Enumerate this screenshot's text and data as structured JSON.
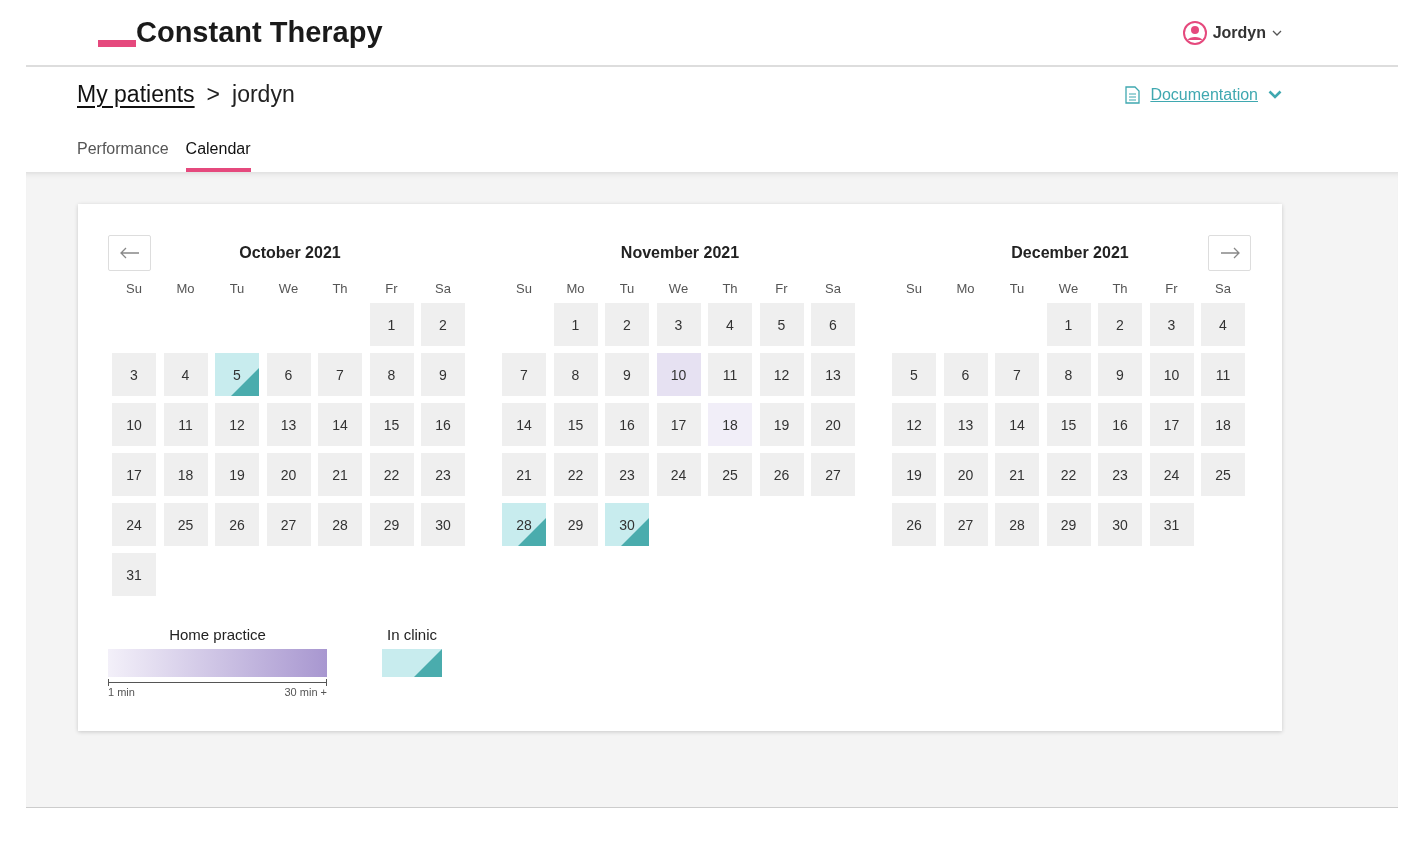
{
  "header": {
    "logo": "Constant Therapy",
    "user": "Jordyn"
  },
  "breadcrumb": {
    "link": "My patients",
    "separator": ">",
    "current": "jordyn"
  },
  "documentation": "Documentation",
  "tabs": [
    {
      "label": "Performance",
      "selected": false
    },
    {
      "label": "Calendar",
      "selected": true
    }
  ],
  "months": [
    {
      "title": "October 2021",
      "weekdays": [
        "Su",
        "Mo",
        "Tu",
        "We",
        "Th",
        "Fr",
        "Sa"
      ],
      "days": [
        {
          "kind": "blank"
        },
        {
          "kind": "blank"
        },
        {
          "kind": "blank"
        },
        {
          "kind": "blank"
        },
        {
          "kind": "blank"
        },
        {
          "day": "1",
          "kind": "none"
        },
        {
          "day": "2",
          "kind": "none"
        },
        {
          "day": "3",
          "kind": "none"
        },
        {
          "day": "4",
          "kind": "none"
        },
        {
          "day": "5",
          "kind": "clinic"
        },
        {
          "day": "6",
          "kind": "none"
        },
        {
          "day": "7",
          "kind": "none"
        },
        {
          "day": "8",
          "kind": "none"
        },
        {
          "day": "9",
          "kind": "none"
        },
        {
          "day": "10",
          "kind": "none"
        },
        {
          "day": "11",
          "kind": "none"
        },
        {
          "day": "12",
          "kind": "none"
        },
        {
          "day": "13",
          "kind": "none"
        },
        {
          "day": "14",
          "kind": "none"
        },
        {
          "day": "15",
          "kind": "none"
        },
        {
          "day": "16",
          "kind": "none"
        },
        {
          "day": "17",
          "kind": "none"
        },
        {
          "day": "18",
          "kind": "none"
        },
        {
          "day": "19",
          "kind": "none"
        },
        {
          "day": "20",
          "kind": "none"
        },
        {
          "day": "21",
          "kind": "none"
        },
        {
          "day": "22",
          "kind": "none"
        },
        {
          "day": "23",
          "kind": "none"
        },
        {
          "day": "24",
          "kind": "none"
        },
        {
          "day": "25",
          "kind": "none"
        },
        {
          "day": "26",
          "kind": "none"
        },
        {
          "day": "27",
          "kind": "none"
        },
        {
          "day": "28",
          "kind": "none"
        },
        {
          "day": "29",
          "kind": "none"
        },
        {
          "day": "30",
          "kind": "none"
        },
        {
          "day": "31",
          "kind": "none"
        }
      ]
    },
    {
      "title": "November 2021",
      "weekdays": [
        "Su",
        "Mo",
        "Tu",
        "We",
        "Th",
        "Fr",
        "Sa"
      ],
      "days": [
        {
          "kind": "blank"
        },
        {
          "day": "1",
          "kind": "none"
        },
        {
          "day": "2",
          "kind": "none"
        },
        {
          "day": "3",
          "kind": "none"
        },
        {
          "day": "4",
          "kind": "none"
        },
        {
          "day": "5",
          "kind": "none"
        },
        {
          "day": "6",
          "kind": "none"
        },
        {
          "day": "7",
          "kind": "none"
        },
        {
          "day": "8",
          "kind": "none"
        },
        {
          "day": "9",
          "kind": "none"
        },
        {
          "day": "10",
          "kind": "home",
          "color": "#e6e1f2"
        },
        {
          "day": "11",
          "kind": "none"
        },
        {
          "day": "12",
          "kind": "none"
        },
        {
          "day": "13",
          "kind": "none"
        },
        {
          "day": "14",
          "kind": "none"
        },
        {
          "day": "15",
          "kind": "none"
        },
        {
          "day": "16",
          "kind": "none"
        },
        {
          "day": "17",
          "kind": "none"
        },
        {
          "day": "18",
          "kind": "home",
          "color": "#f1eef8"
        },
        {
          "day": "19",
          "kind": "none"
        },
        {
          "day": "20",
          "kind": "none"
        },
        {
          "day": "21",
          "kind": "none"
        },
        {
          "day": "22",
          "kind": "none"
        },
        {
          "day": "23",
          "kind": "none"
        },
        {
          "day": "24",
          "kind": "none"
        },
        {
          "day": "25",
          "kind": "none"
        },
        {
          "day": "26",
          "kind": "none"
        },
        {
          "day": "27",
          "kind": "none"
        },
        {
          "day": "28",
          "kind": "clinic"
        },
        {
          "day": "29",
          "kind": "none"
        },
        {
          "day": "30",
          "kind": "clinic"
        }
      ]
    },
    {
      "title": "December 2021",
      "weekdays": [
        "Su",
        "Mo",
        "Tu",
        "We",
        "Th",
        "Fr",
        "Sa"
      ],
      "days": [
        {
          "kind": "blank"
        },
        {
          "kind": "blank"
        },
        {
          "kind": "blank"
        },
        {
          "day": "1",
          "kind": "none"
        },
        {
          "day": "2",
          "kind": "none"
        },
        {
          "day": "3",
          "kind": "none"
        },
        {
          "day": "4",
          "kind": "none"
        },
        {
          "day": "5",
          "kind": "none"
        },
        {
          "day": "6",
          "kind": "none"
        },
        {
          "day": "7",
          "kind": "none"
        },
        {
          "day": "8",
          "kind": "none"
        },
        {
          "day": "9",
          "kind": "none"
        },
        {
          "day": "10",
          "kind": "none"
        },
        {
          "day": "11",
          "kind": "none"
        },
        {
          "day": "12",
          "kind": "none"
        },
        {
          "day": "13",
          "kind": "none"
        },
        {
          "day": "14",
          "kind": "none"
        },
        {
          "day": "15",
          "kind": "none"
        },
        {
          "day": "16",
          "kind": "none"
        },
        {
          "day": "17",
          "kind": "none"
        },
        {
          "day": "18",
          "kind": "none"
        },
        {
          "day": "19",
          "kind": "none"
        },
        {
          "day": "20",
          "kind": "none"
        },
        {
          "day": "21",
          "kind": "none"
        },
        {
          "day": "22",
          "kind": "none"
        },
        {
          "day": "23",
          "kind": "none"
        },
        {
          "day": "24",
          "kind": "none"
        },
        {
          "day": "25",
          "kind": "none"
        },
        {
          "day": "26",
          "kind": "none"
        },
        {
          "day": "27",
          "kind": "none"
        },
        {
          "day": "28",
          "kind": "none"
        },
        {
          "day": "29",
          "kind": "none"
        },
        {
          "day": "30",
          "kind": "none"
        },
        {
          "day": "31",
          "kind": "none"
        }
      ]
    }
  ],
  "legend": {
    "home_title": "Home practice",
    "min_label": "1 min",
    "max_label": "30 min +",
    "clinic_title": "In clinic"
  }
}
